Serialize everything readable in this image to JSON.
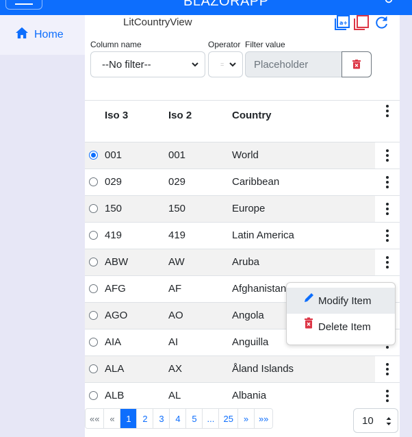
{
  "app": {
    "title": "BLAZORAPP"
  },
  "sidebar": {
    "items": [
      {
        "label": "Home",
        "icon": "home-icon"
      }
    ]
  },
  "view": {
    "title": "LitCountryView"
  },
  "filter": {
    "column_label": "Column name",
    "column_value": "--No filter--",
    "operator_label": "Operator",
    "operator_value": "=",
    "value_label": "Filter value",
    "value_placeholder": "Placeholder"
  },
  "table": {
    "columns": [
      "Iso 3",
      "Iso 2",
      "Country"
    ],
    "rows": [
      {
        "iso3": "001",
        "iso2": "001",
        "country": "World",
        "selected": true
      },
      {
        "iso3": "029",
        "iso2": "029",
        "country": "Caribbean",
        "selected": false
      },
      {
        "iso3": "150",
        "iso2": "150",
        "country": "Europe",
        "selected": false
      },
      {
        "iso3": "419",
        "iso2": "419",
        "country": "Latin America",
        "selected": false
      },
      {
        "iso3": "ABW",
        "iso2": "AW",
        "country": "Aruba",
        "selected": false
      },
      {
        "iso3": "AFG",
        "iso2": "AF",
        "country": "Afghanistan",
        "selected": false
      },
      {
        "iso3": "AGO",
        "iso2": "AO",
        "country": "Angola",
        "selected": false
      },
      {
        "iso3": "AIA",
        "iso2": "AI",
        "country": "Anguilla",
        "selected": false
      },
      {
        "iso3": "ALA",
        "iso2": "AX",
        "country": "Åland Islands",
        "selected": false
      },
      {
        "iso3": "ALB",
        "iso2": "AL",
        "country": "Albania",
        "selected": false
      }
    ]
  },
  "context_menu": {
    "modify_label": "Modify Item",
    "delete_label": "Delete Item"
  },
  "pagination": {
    "items": [
      "««",
      "«",
      "1",
      "2",
      "3",
      "4",
      "5",
      "...",
      "25",
      "»",
      "»»"
    ],
    "active": "1",
    "page_size": "10"
  },
  "colors": {
    "primary": "#0d6efd",
    "danger": "#dc3545",
    "sidebar": "#e7e7f6"
  }
}
